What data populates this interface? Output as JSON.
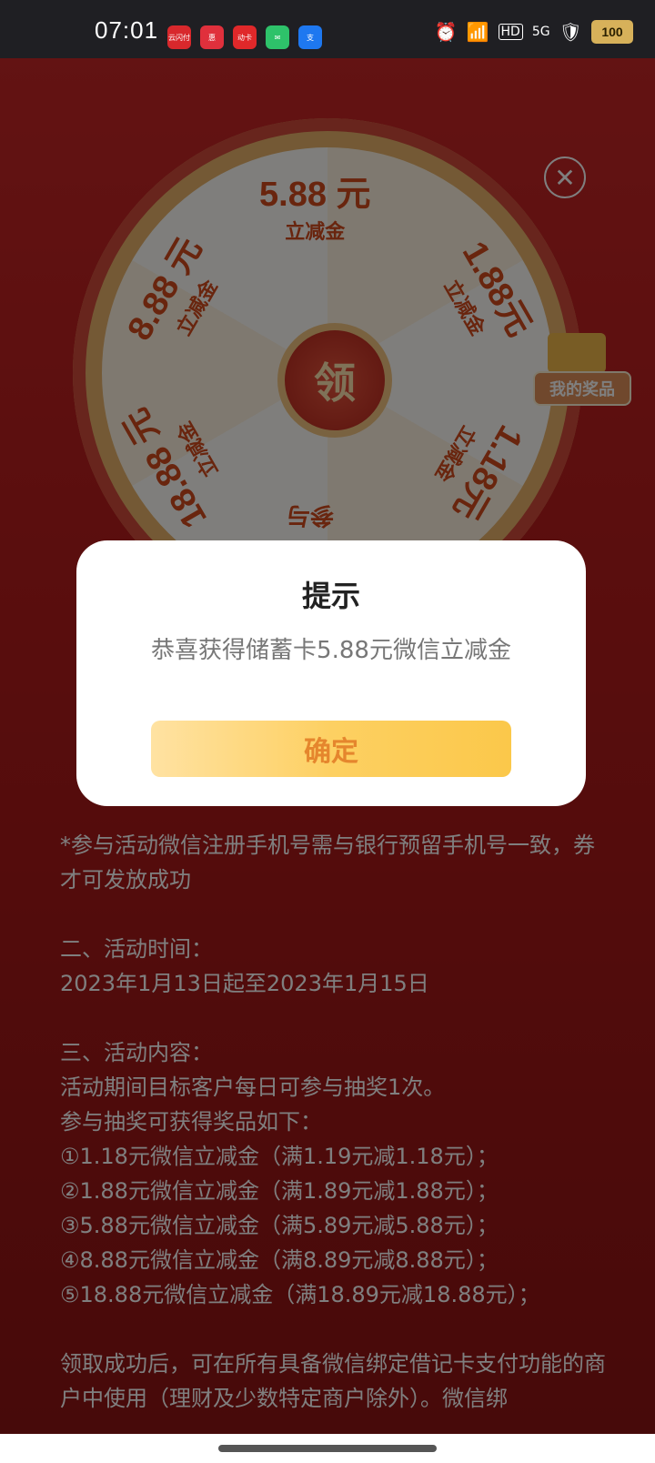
{
  "status_bar": {
    "time": "07:01",
    "apps": [
      {
        "name": "app-icon-1",
        "label": "云闪付",
        "color": "#d8282c"
      },
      {
        "name": "app-icon-2",
        "label": "惠",
        "color": "#e0303c"
      },
      {
        "name": "app-icon-3",
        "label": "动卡",
        "color": "#e0282a"
      },
      {
        "name": "app-icon-4",
        "label": "✉",
        "color": "#2ec26a"
      },
      {
        "name": "app-icon-5",
        "label": "支",
        "color": "#1e78f0"
      }
    ],
    "hd": "HD",
    "network": "5G",
    "battery": "100"
  },
  "wheel": {
    "segments": [
      {
        "amount": "5.88 元",
        "sub": "立减金"
      },
      {
        "amount": "1.88元",
        "sub": "立减金"
      },
      {
        "amount": "1.18元",
        "sub": "立减金"
      },
      {
        "amount": "参与",
        "sub": ""
      },
      {
        "amount": "18.88 元",
        "sub": "立减金"
      },
      {
        "amount": "8.88 元",
        "sub": "立减金"
      }
    ],
    "center_label": "领"
  },
  "my_prizes_label": "我的奖品",
  "rules": {
    "note": "*参与活动微信注册手机号需与银行预留手机号一致，券才可发放成功",
    "time_title": "二、活动时间：",
    "time_value": "2023年1月13日起至2023年1月15日",
    "content_title": "三、活动内容：",
    "content_lines": [
      "活动期间目标客户每日可参与抽奖1次。",
      "参与抽奖可获得奖品如下：",
      "①1.18元微信立减金（满1.19元减1.18元）；",
      "②1.88元微信立减金（满1.89元减1.88元）；",
      "③5.88元微信立减金（满5.89元减5.88元）；",
      "④8.88元微信立减金（满8.89元减8.88元）；",
      "⑤18.88元微信立减金（满18.89元减18.88元）；"
    ],
    "footer": "领取成功后，可在所有具备微信绑定借记卡支付功能的商户中使用（理财及少数特定商户除外）。微信绑"
  },
  "dialog": {
    "title": "提示",
    "message": "恭喜获得储蓄卡5.88元微信立减金",
    "ok_label": "确定"
  }
}
